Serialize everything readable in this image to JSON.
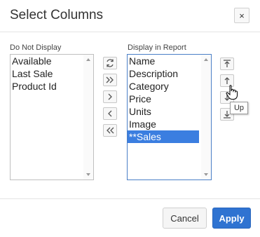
{
  "dialog": {
    "title": "Select Columns",
    "close_icon": "×"
  },
  "left_list": {
    "label": "Do Not Display",
    "items": [
      "Available",
      "Last Sale",
      "Product Id"
    ]
  },
  "right_list": {
    "label": "Display in Report",
    "items": [
      "Name",
      "Description",
      "Category",
      "Price",
      "Units",
      "Image",
      "**Sales"
    ],
    "selected_item": "**Sales"
  },
  "shuttle_buttons": {
    "reset_icon": "reset-icon",
    "move_all_icon": "double-chevron-right-icon",
    "move_icon": "chevron-right-icon",
    "remove_icon": "chevron-left-icon",
    "remove_all_icon": "double-chevron-left-icon"
  },
  "order_buttons": {
    "top_icon": "move-to-top-icon",
    "up_icon": "move-up-icon",
    "down_icon": "move-down-icon",
    "bottom_icon": "move-to-bottom-icon"
  },
  "tooltip": "Up",
  "footer": {
    "cancel_label": "Cancel",
    "apply_label": "Apply"
  },
  "colors": {
    "selection": "#3b7ee0",
    "apply_button": "#2f73d1"
  }
}
